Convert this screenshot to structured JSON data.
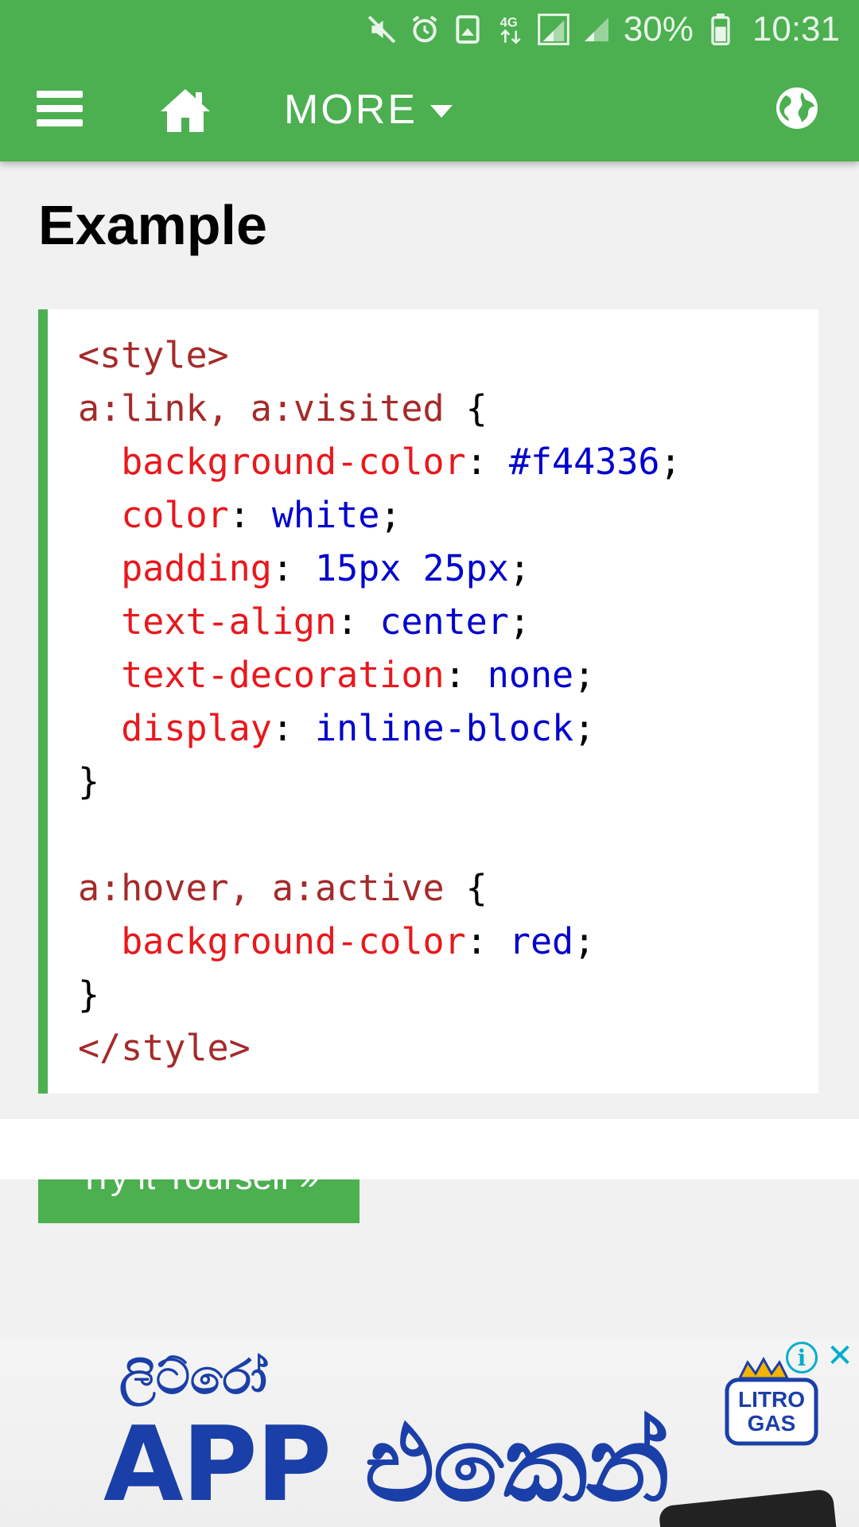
{
  "status_bar": {
    "battery": "30%",
    "time": "10:31",
    "icons": [
      "mute-icon",
      "alarm-icon",
      "data-saver-icon",
      "4g-icon",
      "signal-icon",
      "signal-2-icon",
      "battery-icon"
    ]
  },
  "nav": {
    "menu_icon": "hamburger-menu-icon",
    "home_icon": "home-icon",
    "more_label": "MORE",
    "globe_icon": "globe-icon",
    "accent_color": "#4caf50"
  },
  "main": {
    "heading": "Example",
    "code_lines": [
      "<style>",
      "a:link, a:visited {",
      "  background-color: #f44336;",
      "  color: white;",
      "  padding: 15px 25px;",
      "  text-align: center;",
      "  text-decoration: none;",
      "  display: inline-block;",
      "}",
      "",
      "a:hover, a:active {",
      "  background-color: red;",
      "}",
      "</style>"
    ],
    "try_button_label": "Try it Yourself »"
  },
  "ad": {
    "small_text": "ලිට්රෝ",
    "big_text": "APP එකෙන්",
    "logo_text": [
      "LITRO",
      "GAS"
    ],
    "info_icon": "info-icon",
    "close_icon": "close-icon"
  }
}
